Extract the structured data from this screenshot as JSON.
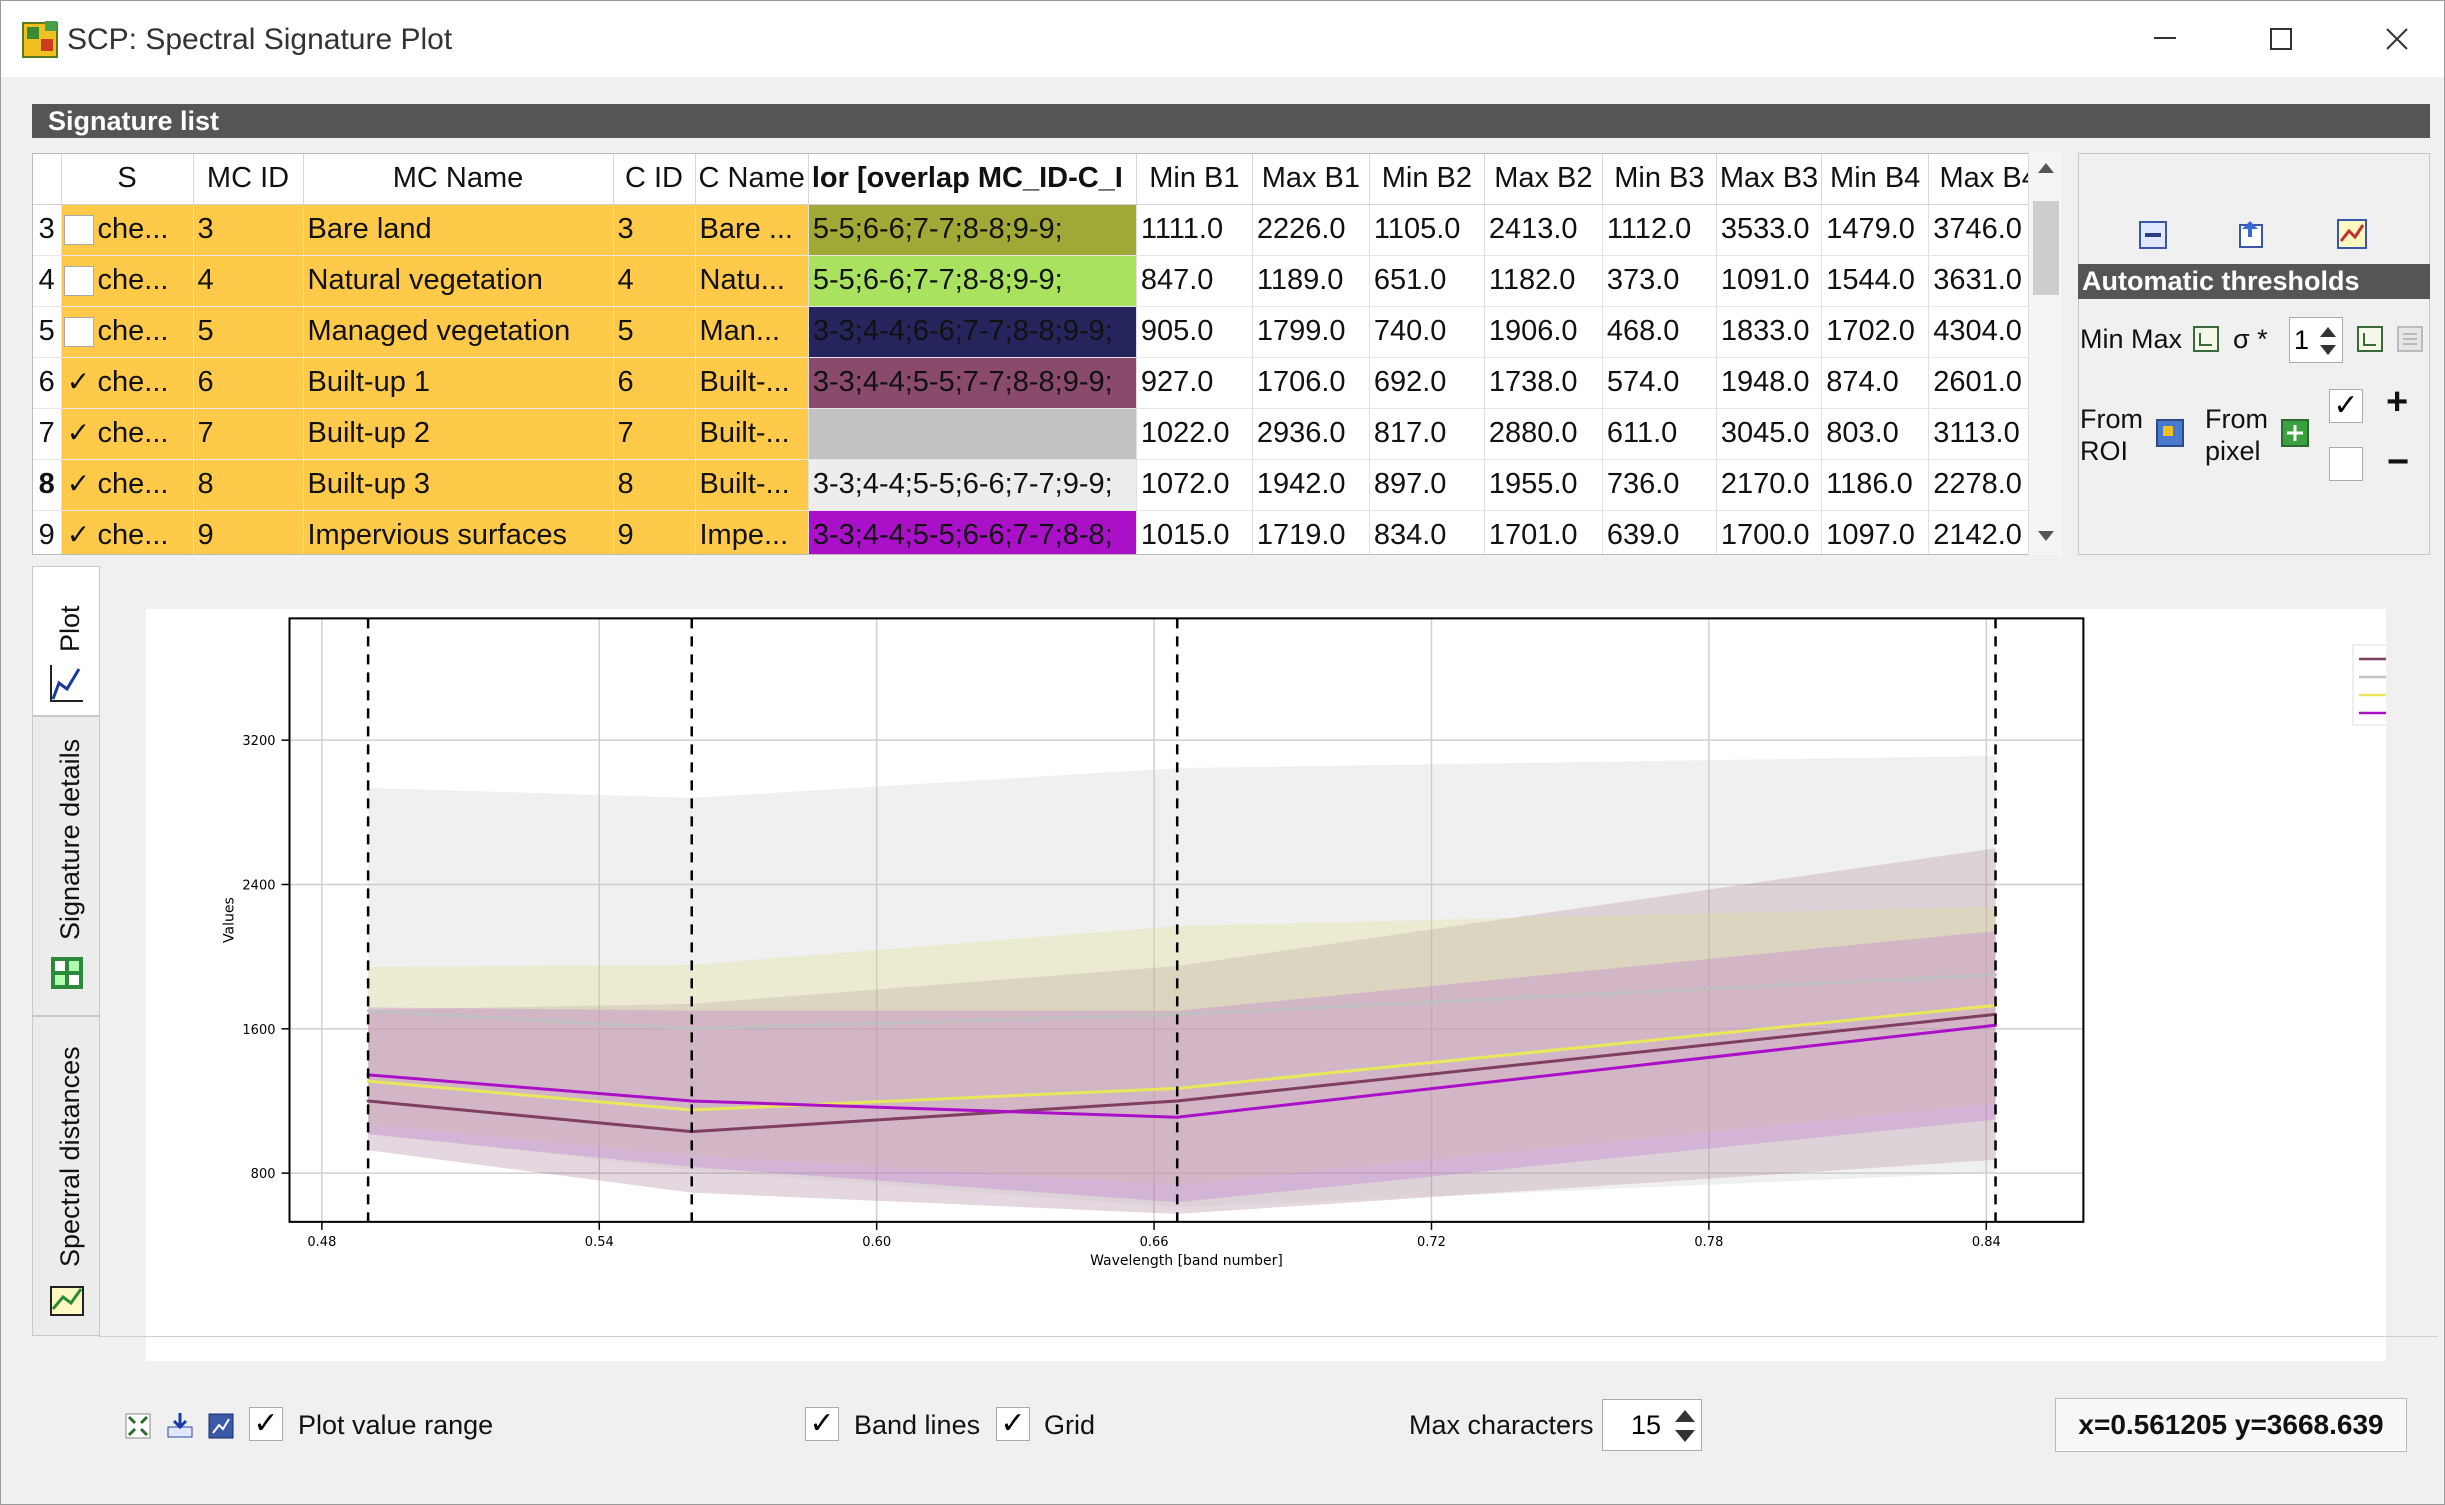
{
  "window": {
    "title": "SCP: Spectral Signature Plot"
  },
  "signature_list": {
    "title": "Signature list",
    "columns": [
      "S",
      "MC ID",
      "MC Name",
      "C ID",
      "C Name",
      "Color [overlap MC_ID-C_ID]",
      "Min B1",
      "Max B1",
      "Min B2",
      "Max B2",
      "Min B3",
      "Max B3",
      "Min B4",
      "Max B4"
    ],
    "header_display": [
      "S",
      "MC ID",
      "MC Name",
      "C ID",
      "C Name",
      "lor [overlap MC_ID-C_I",
      "Min B1",
      "Max B1",
      "Min B2",
      "Max B2",
      "Min B3",
      "Max B3",
      "Min B4",
      "Max B4"
    ],
    "rows": [
      {
        "num": "3",
        "checked": false,
        "s": "che...",
        "mcid": "3",
        "mcname": "Bare land",
        "cid": "3",
        "cname": "Bare ...",
        "overlap": "5-5;6-6;7-7;8-8;9-9;",
        "color": "#a0a836",
        "textcolor": "#111111",
        "v": [
          "1111.0",
          "2226.0",
          "1105.0",
          "2413.0",
          "1112.0",
          "3533.0",
          "1479.0",
          "3746.0"
        ]
      },
      {
        "num": "4",
        "checked": false,
        "s": "che...",
        "mcid": "4",
        "mcname": "Natural vegetation",
        "cid": "4",
        "cname": "Natu...",
        "overlap": "5-5;6-6;7-7;8-8;9-9;",
        "color": "#a8e25e",
        "textcolor": "#111111",
        "v": [
          "847.0",
          "1189.0",
          "651.0",
          "1182.0",
          "373.0",
          "1091.0",
          "1544.0",
          "3631.0"
        ]
      },
      {
        "num": "5",
        "checked": false,
        "s": "che...",
        "mcid": "5",
        "mcname": "Managed vegetation",
        "cid": "5",
        "cname": "Man...",
        "overlap": "3-3;4-4;6-6;7-7;8-8;9-9;",
        "color": "#26245c",
        "textcolor": "#111111",
        "v": [
          "905.0",
          "1799.0",
          "740.0",
          "1906.0",
          "468.0",
          "1833.0",
          "1702.0",
          "4304.0"
        ]
      },
      {
        "num": "6",
        "checked": true,
        "s": "che...",
        "mcid": "6",
        "mcname": "Built-up 1",
        "cid": "6",
        "cname": "Built-...",
        "overlap": "3-3;4-4;5-5;7-7;8-8;9-9;",
        "color": "#8a4a6c",
        "textcolor": "#111111",
        "v": [
          "927.0",
          "1706.0",
          "692.0",
          "1738.0",
          "574.0",
          "1948.0",
          "874.0",
          "2601.0"
        ]
      },
      {
        "num": "7",
        "checked": true,
        "s": "che...",
        "mcid": "7",
        "mcname": "Built-up 2",
        "cid": "7",
        "cname": "Built-...",
        "overlap": "",
        "color": "#c2c2c2",
        "textcolor": "#111111",
        "v": [
          "1022.0",
          "2936.0",
          "817.0",
          "2880.0",
          "611.0",
          "3045.0",
          "803.0",
          "3113.0"
        ]
      },
      {
        "num": "8",
        "checked": true,
        "s": "che...",
        "mcid": "8",
        "mcname": "Built-up 3",
        "cid": "8",
        "cname": "Built-...",
        "overlap": "3-3;4-4;5-5;6-6;7-7;9-9;",
        "color": "#ededed",
        "textcolor": "#111111",
        "v": [
          "1072.0",
          "1942.0",
          "897.0",
          "1955.0",
          "736.0",
          "2170.0",
          "1186.0",
          "2278.0"
        ]
      },
      {
        "num": "9",
        "checked": true,
        "s": "che...",
        "mcid": "9",
        "mcname": "Impervious surfaces",
        "cid": "9",
        "cname": "Impe...",
        "overlap": "3-3;4-4;5-5;6-6;7-7;8-8;",
        "color": "#aa10c8",
        "textcolor": "#111111",
        "v": [
          "1015.0",
          "1719.0",
          "834.0",
          "1701.0",
          "639.0",
          "1700.0",
          "1097.0",
          "2142.0"
        ]
      }
    ]
  },
  "thresholds": {
    "title": "Automatic  thresholds",
    "min_max_label": "Min Max",
    "sigma_label": "σ *",
    "sigma_value": "1",
    "from_roi_label": "From ROI",
    "from_roi_line1": "From",
    "from_roi_line2": "ROI",
    "from_pixel_line1": "From",
    "from_pixel_line2": "pixel",
    "plus": "+",
    "minus": "−"
  },
  "tabs": {
    "plot": "Plot",
    "signature_details": "Signature details",
    "spectral_distances": "Spectral distances"
  },
  "chart_data": {
    "type": "line",
    "xlabel": "Wavelength [band number]",
    "ylabel": "Values",
    "xlim": [
      0.473,
      0.861
    ],
    "ylim": [
      530,
      3875
    ],
    "xticks": [
      "0.48",
      "0.54",
      "0.60",
      "0.66",
      "0.72",
      "0.78",
      "0.84"
    ],
    "yticks": [
      "800",
      "1600",
      "2400",
      "3200"
    ],
    "band_lines": [
      0.49,
      0.56,
      0.665,
      0.842
    ],
    "grid": true,
    "legend_placement": "top-right",
    "x": [
      0.49,
      0.56,
      0.665,
      0.842
    ],
    "series": [
      {
        "color": "#7f3f62",
        "values": [
          1200,
          1030,
          1200,
          1680
        ],
        "min": [
          927,
          692,
          574,
          874
        ],
        "max": [
          1706,
          1738,
          1948,
          2601
        ],
        "fill": "#8a4a6c",
        "opacity": 0.22
      },
      {
        "color": "#c0c0c0",
        "values": [
          1700,
          1600,
          1680,
          1900
        ],
        "min": [
          1022,
          817,
          611,
          803
        ],
        "max": [
          2936,
          2880,
          3045,
          3113
        ],
        "fill": "#c2c2c2",
        "opacity": 0.25
      },
      {
        "color": "#e8e85a",
        "values": [
          1310,
          1150,
          1270,
          1730
        ],
        "min": [
          1072,
          897,
          736,
          1186
        ],
        "max": [
          1942,
          1955,
          2170,
          2278
        ],
        "fill": "#e0e080",
        "opacity": 0.28
      },
      {
        "color": "#aa10c8",
        "values": [
          1345,
          1200,
          1110,
          1620
        ],
        "min": [
          1015,
          834,
          639,
          1097
        ],
        "max": [
          1719,
          1701,
          1700,
          2142
        ],
        "fill": "#c070d0",
        "opacity": 0.3
      }
    ]
  },
  "bottom": {
    "plot_value_range": "Plot value range",
    "band_lines": "Band lines",
    "grid": "Grid",
    "max_characters": "Max characters",
    "max_characters_value": "15",
    "coords": "x=0.561205 y=3668.639"
  }
}
